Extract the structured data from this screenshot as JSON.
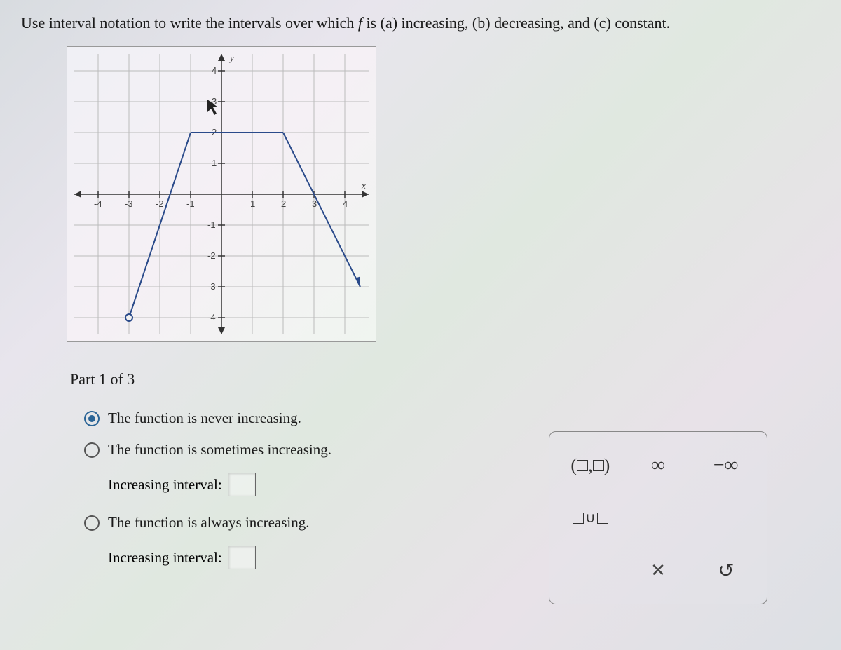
{
  "question": {
    "prefix": "Use interval notation to write the intervals over which ",
    "f_symbol": "f",
    "suffix": " is (a) increasing, (b) decreasing, and (c) constant."
  },
  "part_label": "Part 1 of 3",
  "options": {
    "never": "The function is never increasing.",
    "sometimes": "The function is sometimes increasing.",
    "always": "The function is always increasing.",
    "interval_label": "Increasing interval:"
  },
  "tools": {
    "interval": "(□,□)",
    "infinity": "∞",
    "neg_infinity": "−∞",
    "union": "□∪□",
    "clear": "×",
    "reset": "↶"
  },
  "chart_data": {
    "type": "line",
    "title": "",
    "xlabel": "x",
    "ylabel": "y",
    "xlim": [
      -4.5,
      4.5
    ],
    "ylim": [
      -4.5,
      4.5
    ],
    "x_ticks": [
      -4,
      -3,
      -2,
      -1,
      1,
      2,
      3,
      4
    ],
    "y_ticks": [
      -4,
      -3,
      -2,
      -1,
      1,
      2,
      3,
      4
    ],
    "series": [
      {
        "name": "f",
        "segments": [
          {
            "points": [
              [
                -3,
                -4
              ],
              [
                -1,
                2
              ]
            ],
            "start_open": true,
            "end_open": false
          },
          {
            "points": [
              [
                -1,
                2
              ],
              [
                2,
                2
              ]
            ],
            "start_open": false,
            "end_open": false
          },
          {
            "points": [
              [
                2,
                2
              ],
              [
                4.5,
                -3
              ]
            ],
            "start_open": false,
            "end_arrow": true
          }
        ]
      }
    ],
    "open_points": [
      [
        -3,
        -4
      ]
    ],
    "arrows": {
      "x_positive": true,
      "x_negative": true,
      "y_positive": true,
      "y_negative": true,
      "right_segment_end": true
    }
  }
}
